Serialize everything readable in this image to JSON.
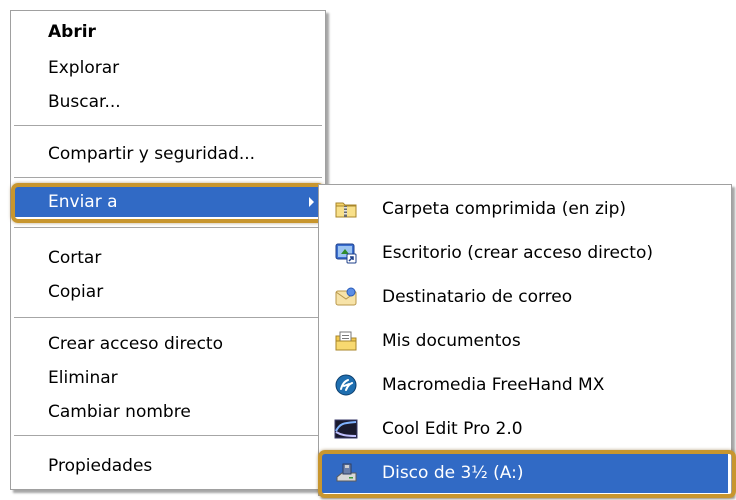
{
  "context_menu": {
    "items": [
      {
        "label": "Abrir"
      },
      {
        "label": "Explorar"
      },
      {
        "label": "Buscar..."
      },
      {
        "label": "Compartir y seguridad..."
      },
      {
        "label": "Enviar a"
      },
      {
        "label": "Cortar"
      },
      {
        "label": "Copiar"
      },
      {
        "label": "Crear acceso directo"
      },
      {
        "label": "Eliminar"
      },
      {
        "label": "Cambiar nombre"
      },
      {
        "label": "Propiedades"
      }
    ]
  },
  "send_to_menu": {
    "items": [
      {
        "label": "Carpeta comprimida (en zip)",
        "icon": "zip-folder-icon"
      },
      {
        "label": "Escritorio (crear acceso directo)",
        "icon": "desktop-icon"
      },
      {
        "label": "Destinatario de correo",
        "icon": "mail-recipient-icon"
      },
      {
        "label": "Mis documentos",
        "icon": "my-documents-icon"
      },
      {
        "label": "Macromedia FreeHand MX",
        "icon": "freehand-icon"
      },
      {
        "label": "Cool Edit Pro 2.0",
        "icon": "cool-edit-icon"
      },
      {
        "label": "Disco de 3½ (A:)",
        "icon": "floppy-drive-icon"
      }
    ]
  },
  "colors": {
    "selection": "#316ac5",
    "highlight_ring": "#c8962e",
    "separator": "#a6a6a6"
  }
}
